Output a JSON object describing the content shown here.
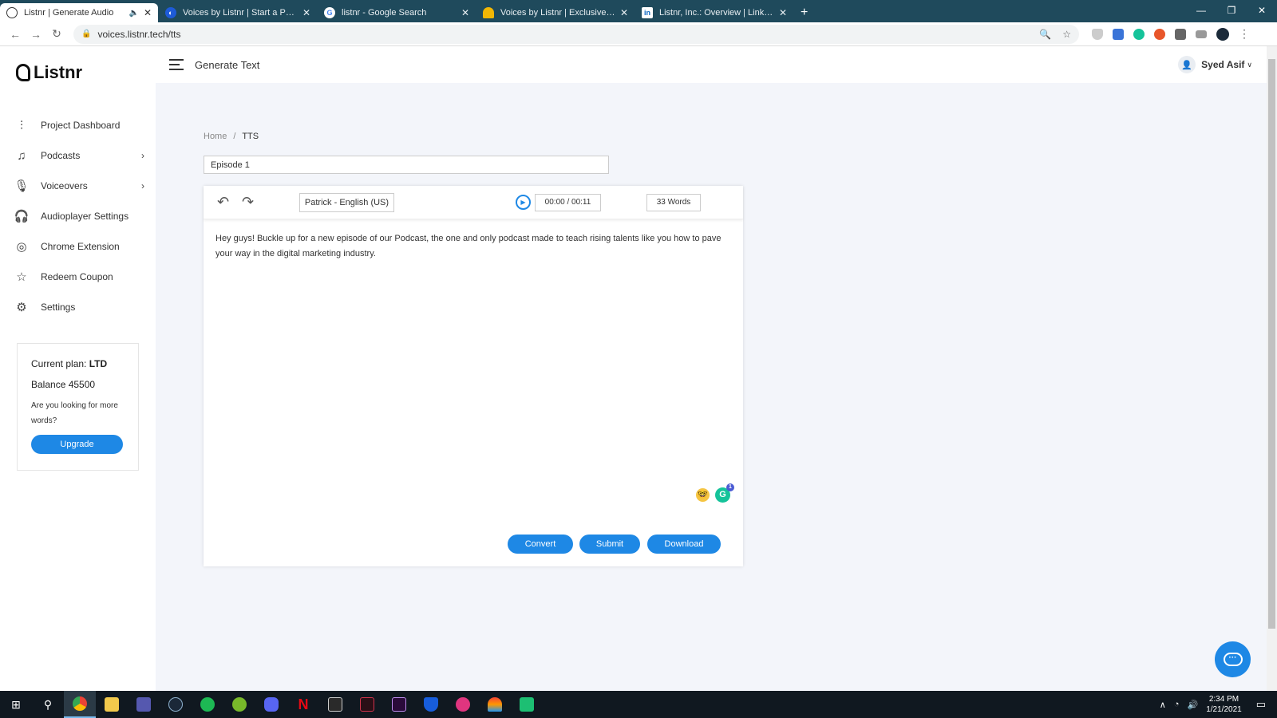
{
  "browser": {
    "tabs": [
      {
        "title": "Listnr | Generate Audio",
        "favicon": "listnr-icon",
        "active": true,
        "audio": true
      },
      {
        "title": "Voices by Listnr | Start a Podcast",
        "favicon": "listnr-blue-icon",
        "active": false
      },
      {
        "title": "listnr - Google Search",
        "favicon": "google-icon",
        "active": false
      },
      {
        "title": "Voices by Listnr | Exclusive Offer",
        "favicon": "taco-icon",
        "active": false
      },
      {
        "title": "Listnr, Inc.: Overview | LinkedIn",
        "favicon": "linkedin-icon",
        "active": false
      }
    ],
    "url": "voices.listnr.tech/tts"
  },
  "app": {
    "logo_text": "Listnr",
    "header_title": "Generate Text",
    "user_name": "Syed Asif",
    "nav": [
      {
        "label": "Project Dashboard",
        "icon": "sliders-icon",
        "chevron": false
      },
      {
        "label": "Podcasts",
        "icon": "music-note-icon",
        "chevron": true
      },
      {
        "label": "Voiceovers",
        "icon": "microphone-icon",
        "chevron": true
      },
      {
        "label": "Audioplayer Settings",
        "icon": "headphones-icon",
        "chevron": false
      },
      {
        "label": "Chrome Extension",
        "icon": "chrome-icon",
        "chevron": false
      },
      {
        "label": "Redeem Coupon",
        "icon": "star-icon",
        "chevron": false
      },
      {
        "label": "Settings",
        "icon": "gear-icon",
        "chevron": false
      }
    ],
    "plan": {
      "current_label": "Current plan:",
      "current_value": "LTD",
      "balance": "Balance 45500",
      "more_words": "Are you looking for more words?",
      "upgrade": "Upgrade"
    },
    "breadcrumb": {
      "home": "Home",
      "sep": "/",
      "current": "TTS"
    },
    "episode_name": "Episode 1",
    "editor": {
      "voice": "Patrick - English (US)",
      "time": "00:00 / 00:11",
      "words": "33 Words",
      "text": "Hey guys! Buckle up for a new episode of our Podcast, the one and only podcast made to teach rising talents like you how to pave your way in the digital marketing industry.",
      "grammarly_badge": "1",
      "convert": "Convert",
      "submit": "Submit",
      "download": "Download"
    }
  },
  "taskbar": {
    "time": "2:34 PM",
    "date": "1/21/2021"
  },
  "colors": {
    "accent": "#1e88e5",
    "tabbar": "#1f4a5c",
    "taskbar": "#101820"
  }
}
